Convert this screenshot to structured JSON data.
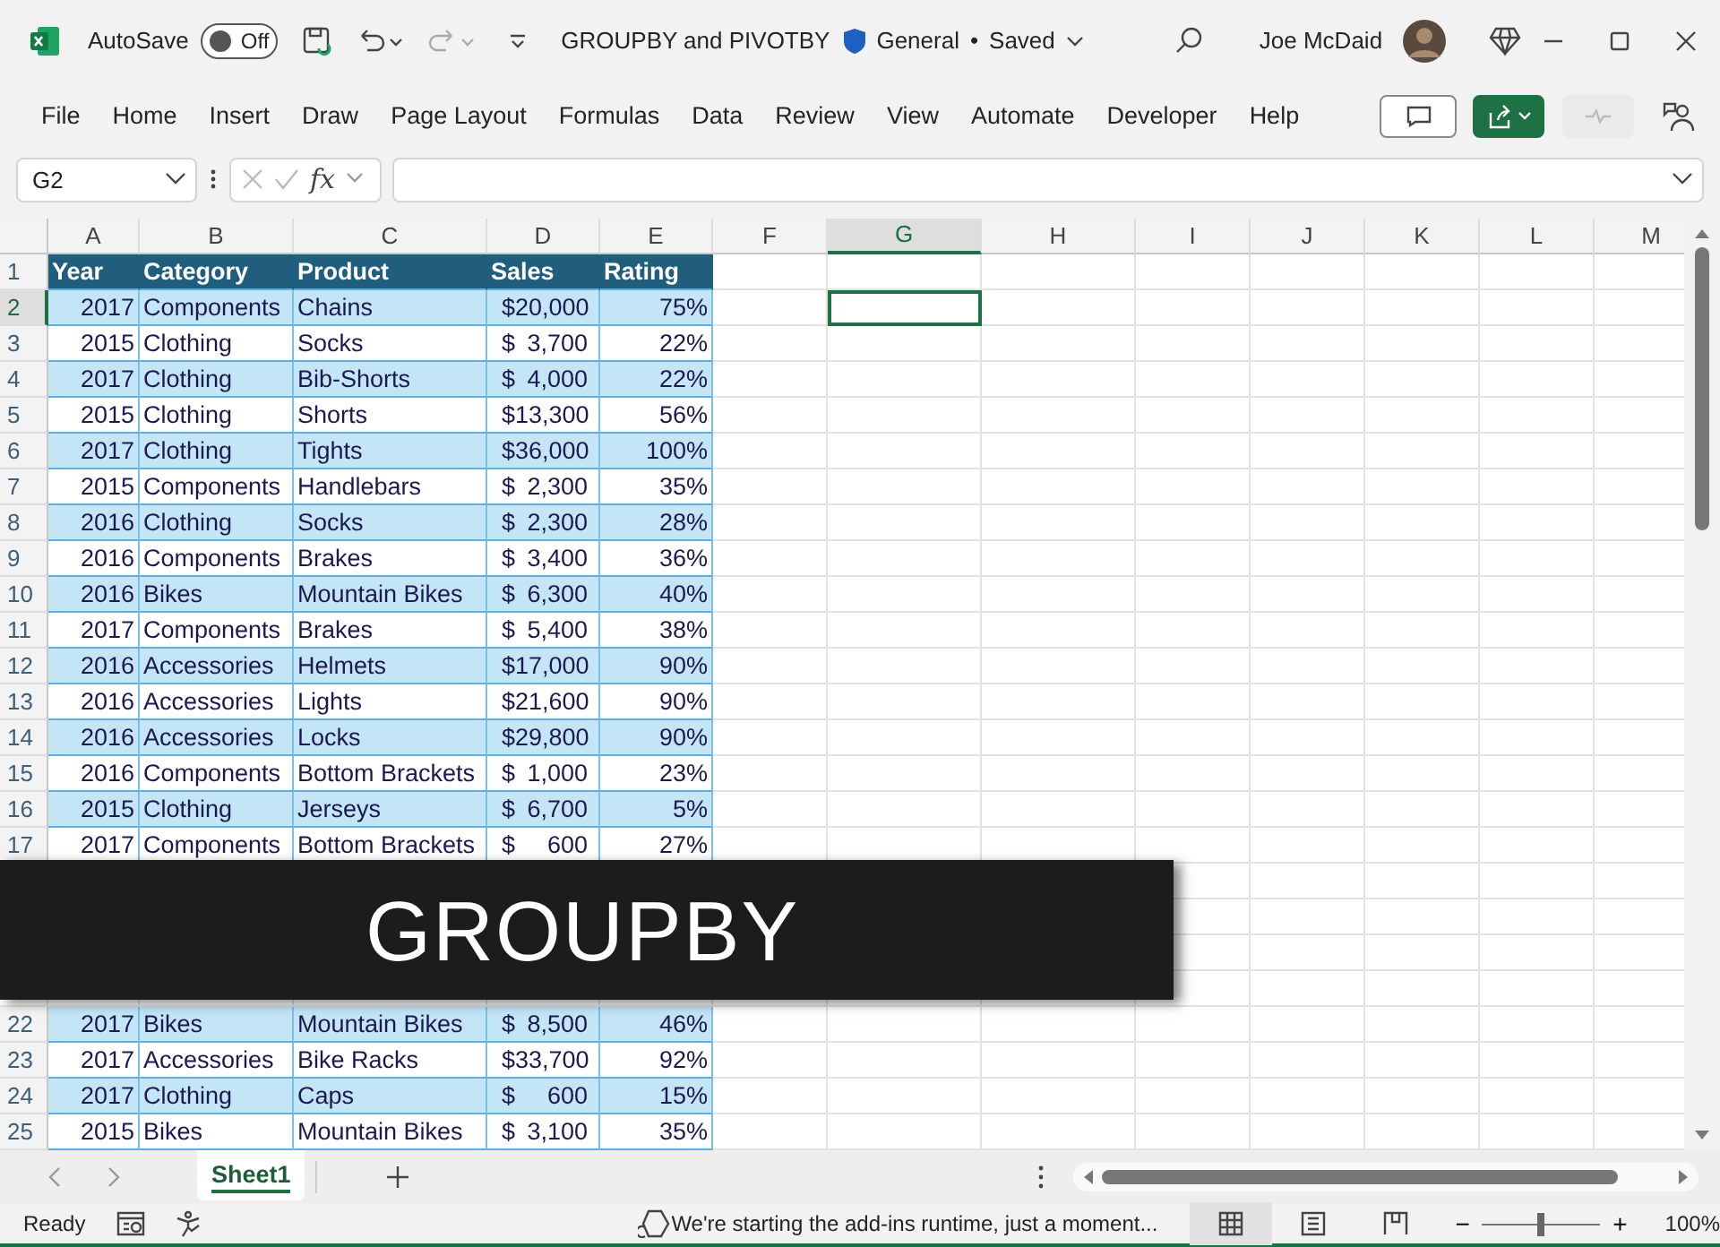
{
  "title_bar": {
    "autosave_label": "AutoSave",
    "autosave_state": "Off",
    "autosave_on": false,
    "document_title": "GROUPBY and PIVOTBY",
    "sensitivity": "General",
    "separator": "•",
    "save_status": "Saved",
    "user_name": "Joe McDaid"
  },
  "ribbon_tabs": [
    "File",
    "Home",
    "Insert",
    "Draw",
    "Page Layout",
    "Formulas",
    "Data",
    "Review",
    "View",
    "Automate",
    "Developer",
    "Help"
  ],
  "formula_bar": {
    "name_box": "G2",
    "function_label": "fx"
  },
  "grid": {
    "columns": [
      {
        "letter": "A",
        "selected": false
      },
      {
        "letter": "B",
        "selected": false
      },
      {
        "letter": "C",
        "selected": false
      },
      {
        "letter": "D",
        "selected": false
      },
      {
        "letter": "E",
        "selected": false
      },
      {
        "letter": "F",
        "selected": false
      },
      {
        "letter": "G",
        "selected": true
      },
      {
        "letter": "H",
        "selected": false
      },
      {
        "letter": "I",
        "selected": false
      },
      {
        "letter": "J",
        "selected": false
      },
      {
        "letter": "K",
        "selected": false
      },
      {
        "letter": "L",
        "selected": false
      },
      {
        "letter": "M",
        "selected": false
      }
    ],
    "table_header": {
      "row_number": "1",
      "cells": [
        "Year",
        "Category",
        "Product",
        "Sales",
        "Rating"
      ]
    },
    "rows": [
      {
        "number": "2",
        "selected": true,
        "banded": true,
        "year": "2017",
        "category": "Components",
        "product": "Chains",
        "currency": "$",
        "sales": "20,000",
        "rating": "75%"
      },
      {
        "number": "3",
        "selected": false,
        "banded": false,
        "year": "2015",
        "category": "Clothing",
        "product": "Socks",
        "currency": "$",
        "sales": "3,700",
        "rating": "22%"
      },
      {
        "number": "4",
        "selected": false,
        "banded": true,
        "year": "2017",
        "category": "Clothing",
        "product": "Bib-Shorts",
        "currency": "$",
        "sales": "4,000",
        "rating": "22%"
      },
      {
        "number": "5",
        "selected": false,
        "banded": false,
        "year": "2015",
        "category": "Clothing",
        "product": "Shorts",
        "currency": "$",
        "sales": "13,300",
        "rating": "56%"
      },
      {
        "number": "6",
        "selected": false,
        "banded": true,
        "year": "2017",
        "category": "Clothing",
        "product": "Tights",
        "currency": "$",
        "sales": "36,000",
        "rating": "100%"
      },
      {
        "number": "7",
        "selected": false,
        "banded": false,
        "year": "2015",
        "category": "Components",
        "product": "Handlebars",
        "currency": "$",
        "sales": "2,300",
        "rating": "35%"
      },
      {
        "number": "8",
        "selected": false,
        "banded": true,
        "year": "2016",
        "category": "Clothing",
        "product": "Socks",
        "currency": "$",
        "sales": "2,300",
        "rating": "28%"
      },
      {
        "number": "9",
        "selected": false,
        "banded": false,
        "year": "2016",
        "category": "Components",
        "product": "Brakes",
        "currency": "$",
        "sales": "3,400",
        "rating": "36%"
      },
      {
        "number": "10",
        "selected": false,
        "banded": true,
        "year": "2016",
        "category": "Bikes",
        "product": "Mountain Bikes",
        "currency": "$",
        "sales": "6,300",
        "rating": "40%"
      },
      {
        "number": "11",
        "selected": false,
        "banded": false,
        "year": "2017",
        "category": "Components",
        "product": "Brakes",
        "currency": "$",
        "sales": "5,400",
        "rating": "38%"
      },
      {
        "number": "12",
        "selected": false,
        "banded": true,
        "year": "2016",
        "category": "Accessories",
        "product": "Helmets",
        "currency": "$",
        "sales": "17,000",
        "rating": "90%"
      },
      {
        "number": "13",
        "selected": false,
        "banded": false,
        "year": "2016",
        "category": "Accessories",
        "product": "Lights",
        "currency": "$",
        "sales": "21,600",
        "rating": "90%"
      },
      {
        "number": "14",
        "selected": false,
        "banded": true,
        "year": "2016",
        "category": "Accessories",
        "product": "Locks",
        "currency": "$",
        "sales": "29,800",
        "rating": "90%"
      },
      {
        "number": "15",
        "selected": false,
        "banded": false,
        "year": "2016",
        "category": "Components",
        "product": "Bottom Brackets",
        "currency": "$",
        "sales": "1,000",
        "rating": "23%"
      },
      {
        "number": "16",
        "selected": false,
        "banded": true,
        "year": "2015",
        "category": "Clothing",
        "product": "Jerseys",
        "currency": "$",
        "sales": "6,700",
        "rating": "5%"
      },
      {
        "number": "17",
        "selected": false,
        "banded": false,
        "year": "2017",
        "category": "Components",
        "product": "Bottom Brackets",
        "currency": "$",
        "sales": "600",
        "rating": "27%"
      },
      {
        "number": "22",
        "selected": false,
        "banded": true,
        "year": "2017",
        "category": "Bikes",
        "product": "Mountain Bikes",
        "currency": "$",
        "sales": "8,500",
        "rating": "46%"
      },
      {
        "number": "23",
        "selected": false,
        "banded": false,
        "year": "2017",
        "category": "Accessories",
        "product": "Bike Racks",
        "currency": "$",
        "sales": "33,700",
        "rating": "92%"
      },
      {
        "number": "24",
        "selected": false,
        "banded": true,
        "year": "2017",
        "category": "Clothing",
        "product": "Caps",
        "currency": "$",
        "sales": "600",
        "rating": "15%"
      },
      {
        "number": "25",
        "selected": false,
        "banded": false,
        "year": "2015",
        "category": "Bikes",
        "product": "Mountain Bikes",
        "currency": "$",
        "sales": "3,100",
        "rating": "35%"
      }
    ]
  },
  "overlay_banner": {
    "text": "GROUPBY"
  },
  "sheet_tabs": [
    {
      "label": "Sheet1",
      "selected": true
    }
  ],
  "status_bar": {
    "mode": "Ready",
    "message": "We're starting the add-ins runtime, just a moment...",
    "zoom": {
      "minus": "−",
      "plus": "+",
      "level": 0.5,
      "reading": "100%"
    }
  }
}
